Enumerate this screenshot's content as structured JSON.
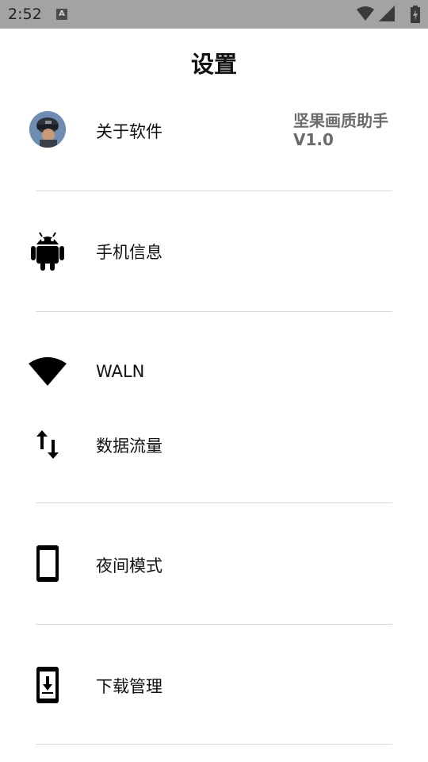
{
  "status_bar": {
    "time": "2:52",
    "notification_icon": "A"
  },
  "header": {
    "title": "设置"
  },
  "settings": {
    "about": {
      "label": "关于软件",
      "app_name": "坚果画质助手",
      "version": "V1.0",
      "icon": "avatar"
    },
    "phone_info": {
      "label": "手机信息",
      "icon": "android-icon"
    },
    "wlan": {
      "label": "WALN",
      "icon": "wifi-icon"
    },
    "data": {
      "label": "数据流量",
      "icon": "data-transfer-icon"
    },
    "night": {
      "label": "夜间模式",
      "icon": "phone-icon"
    },
    "downloads": {
      "label": "下载管理",
      "icon": "download-phone-icon"
    }
  }
}
